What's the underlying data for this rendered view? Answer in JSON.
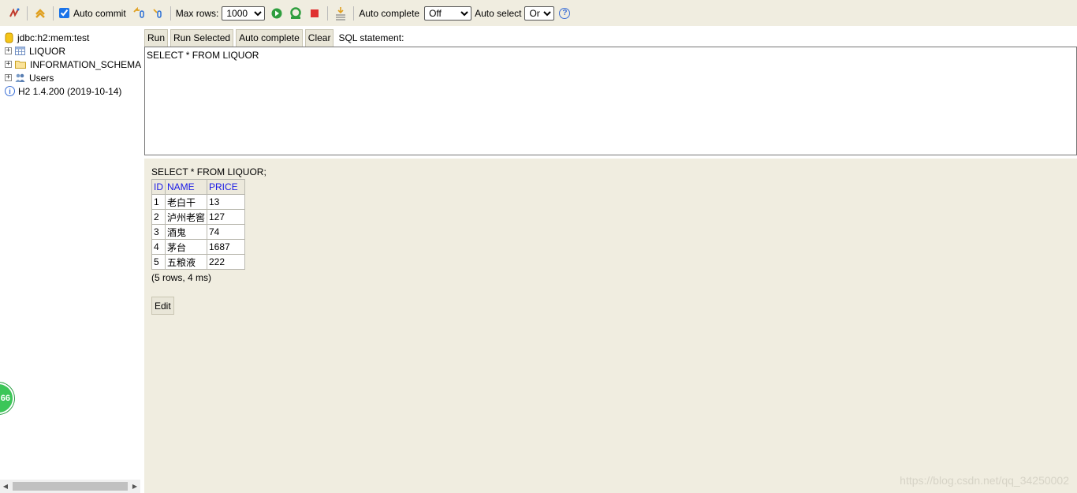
{
  "toolbar": {
    "auto_commit_label": "Auto commit",
    "auto_commit_checked": true,
    "max_rows_label": "Max rows:",
    "max_rows_value": "1000",
    "auto_complete_label": "Auto complete",
    "auto_complete_value": "Off",
    "auto_select_label": "Auto select",
    "auto_select_value": "On"
  },
  "tree": {
    "connection": "jdbc:h2:mem:test",
    "items": [
      {
        "label": "LIQUOR",
        "icon": "table-icon"
      },
      {
        "label": "INFORMATION_SCHEMA",
        "icon": "folder-icon"
      },
      {
        "label": "Users",
        "icon": "users-icon"
      }
    ],
    "version": "H2 1.4.200 (2019-10-14)"
  },
  "query": {
    "buttons": {
      "run": "Run",
      "run_selected": "Run Selected",
      "auto_complete": "Auto complete",
      "clear": "Clear"
    },
    "statement_label": "SQL statement:",
    "sql": "SELECT * FROM LIQUOR"
  },
  "result": {
    "statement": "SELECT * FROM LIQUOR;",
    "columns": [
      "ID",
      "NAME",
      "PRICE"
    ],
    "rows": [
      [
        "1",
        "老白干",
        "13"
      ],
      [
        "2",
        "泸州老窖",
        "127"
      ],
      [
        "3",
        "酒鬼",
        "74"
      ],
      [
        "4",
        "茅台",
        "1687"
      ],
      [
        "5",
        "五粮液",
        "222"
      ]
    ],
    "summary": "(5 rows, 4 ms)",
    "edit_label": "Edit"
  },
  "overlay": {
    "bubble_text": "66",
    "watermark": "https://blog.csdn.net/qq_34250002"
  }
}
